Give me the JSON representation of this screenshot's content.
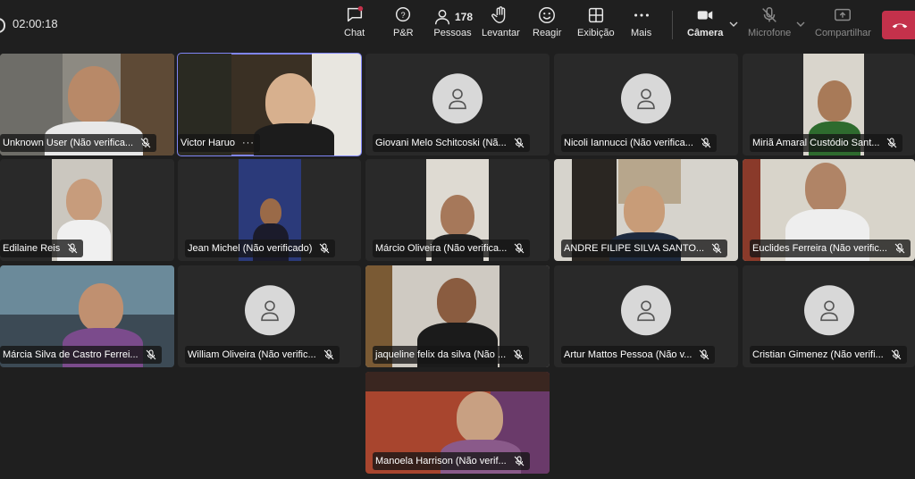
{
  "timer": "02:00:18",
  "toolbar": {
    "chat": "Chat",
    "qa": "P&R",
    "people_count": "178",
    "people": "Pessoas",
    "raise": "Levantar",
    "react": "Reagir",
    "view": "Exibição",
    "more": "Mais",
    "camera": "Câmera",
    "mic": "Microfone",
    "share": "Compartilhar"
  },
  "colors": {
    "accent": "#7f85f5",
    "leave": "#c4314b",
    "background": "#1f1f1f"
  },
  "participants": [
    {
      "name": "Unknown User (Não verifica...",
      "video": true
    },
    {
      "name": "Victor Haruo",
      "video": true,
      "speaking": true,
      "more": "···"
    },
    {
      "name": "Giovani Melo Schitcoski (Nã...",
      "video": false
    },
    {
      "name": "Nicoli Iannucci (Não verifica...",
      "video": false
    },
    {
      "name": "Miriã Amaral Custódio Sant...",
      "video": true
    },
    {
      "name": "Edilaine Reis",
      "video": true
    },
    {
      "name": "Jean Michel (Não verificado)",
      "video": true
    },
    {
      "name": "Márcio Oliveira (Não verifica...",
      "video": true
    },
    {
      "name": "ANDRE FILIPE SILVA SANTO...",
      "video": true
    },
    {
      "name": "Euclides Ferreira (Não verific...",
      "video": true
    },
    {
      "name": "Márcia Silva de Castro Ferrei...",
      "video": true
    },
    {
      "name": "William Oliveira (Não verific...",
      "video": false
    },
    {
      "name": "jaqueline felix da silva (Não ...",
      "video": true
    },
    {
      "name": "Artur Mattos Pessoa (Não v...",
      "video": false
    },
    {
      "name": "Cristian Gimenez (Não verifi...",
      "video": false
    },
    {
      "name": "Manoela Harrison (Não verif...",
      "video": true
    }
  ]
}
